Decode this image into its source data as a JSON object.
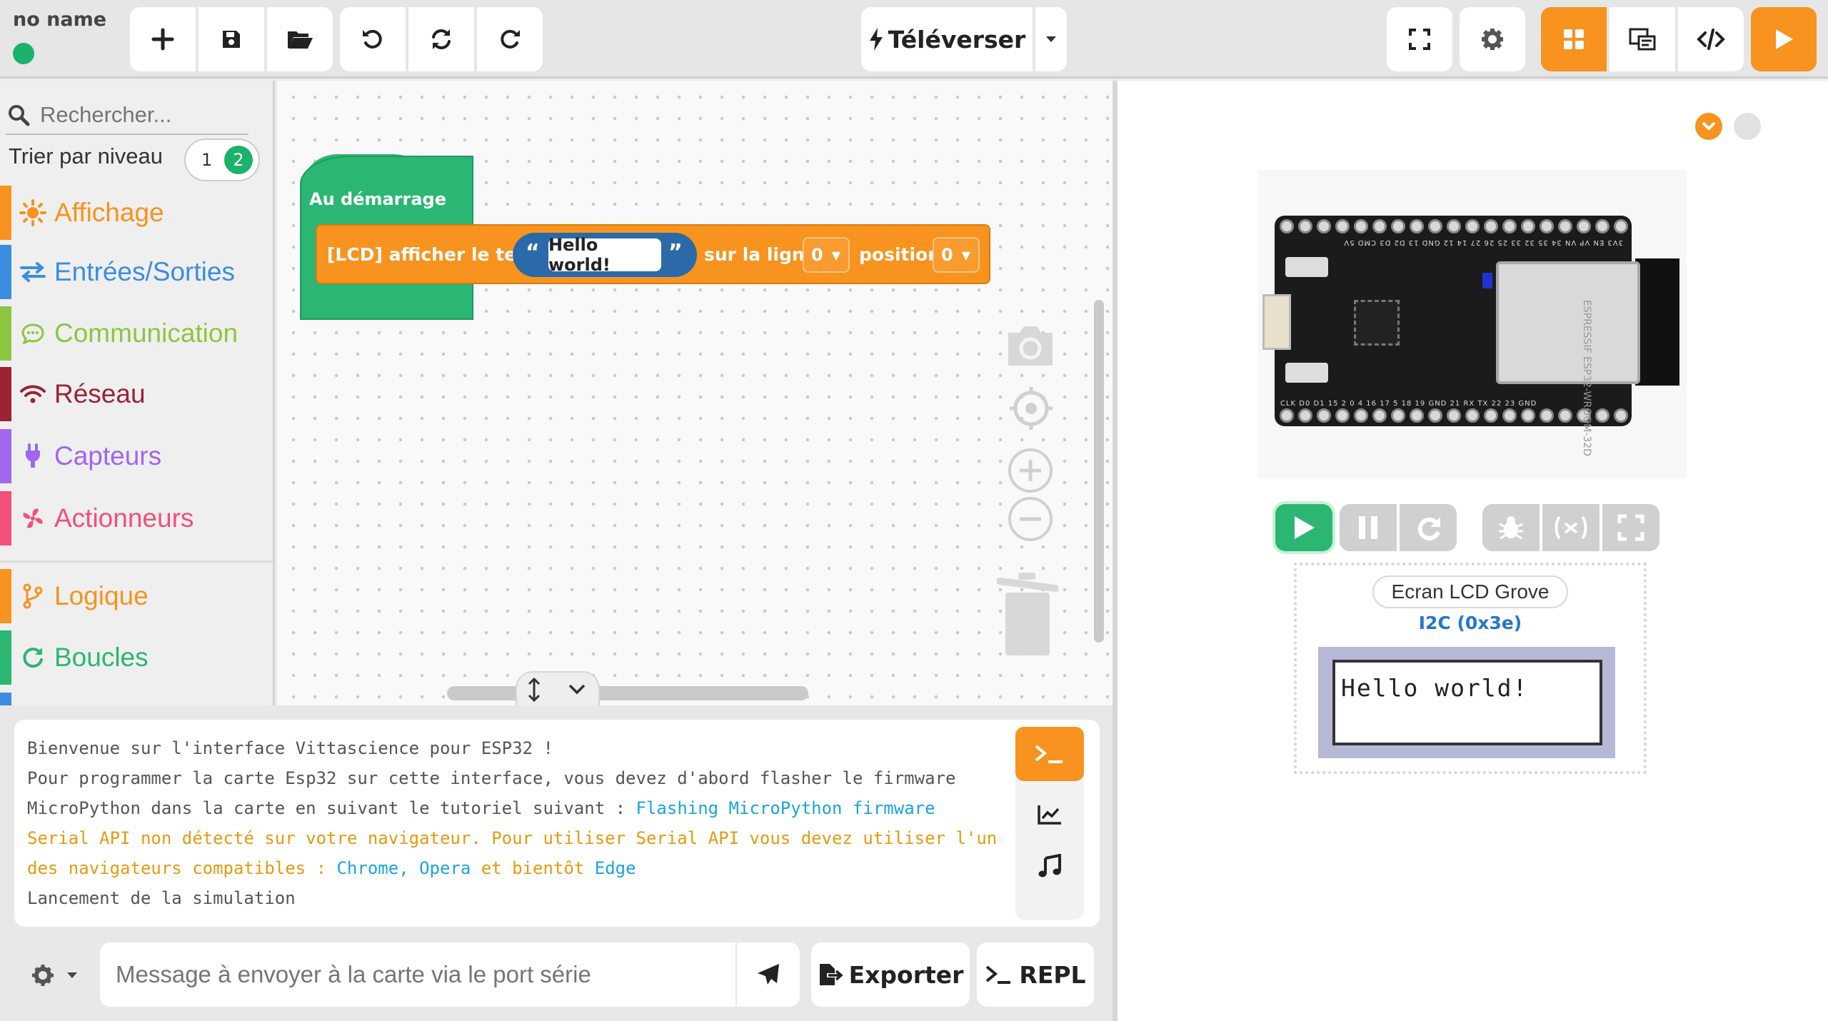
{
  "project": {
    "name": "no name",
    "status_color": "#1bb26b"
  },
  "toolbar": {
    "new_icon": "plus-icon",
    "save_icon": "floppy-icon",
    "open_icon": "folder-open-icon",
    "undo_icon": "undo-icon",
    "sync_icon": "sync-icon",
    "redo_icon": "redo-icon",
    "upload_label": "Téléverser",
    "accent": "#f7931e"
  },
  "sidebar": {
    "search_placeholder": "Rechercher...",
    "sort_label": "Trier par niveau",
    "level_1": "1",
    "level_2": "2",
    "categories": [
      {
        "label": "Affichage",
        "color": "#f7931e",
        "icon": "sun-icon"
      },
      {
        "label": "Entrées/Sorties",
        "color": "#3b8ee0",
        "icon": "arrows-icon"
      },
      {
        "label": "Communication",
        "color": "#8cc63f",
        "icon": "chat-icon"
      },
      {
        "label": "Réseau",
        "color": "#9b2335",
        "icon": "wifi-icon"
      },
      {
        "label": "Capteurs",
        "color": "#a066f0",
        "icon": "plug-icon"
      },
      {
        "label": "Actionneurs",
        "color": "#f0507a",
        "icon": "fan-icon"
      },
      {
        "label": "Logique",
        "color": "#f7931e",
        "icon": "branch-icon"
      },
      {
        "label": "Boucles",
        "color": "#2bb673",
        "icon": "loop-icon"
      }
    ]
  },
  "workspace": {
    "hat_label": "Au démarrage",
    "lcd_label": "[LCD] afficher le texte",
    "text_value": "Hello world!",
    "line_label": "sur la ligne",
    "line_value": "0",
    "position_label": "position",
    "position_value": "0"
  },
  "console": {
    "lines": [
      "Bienvenue sur l'interface Vittascience pour ESP32 !",
      "Pour programmer la carte Esp32 sur cette interface, vous devez d'abord flasher le firmware",
      "MicroPython dans la carte en suivant le tutoriel suivant : ",
      "Serial API non détecté sur votre navigateur. Pour utiliser Serial API vous devez utiliser l'un",
      "des navigateurs compatibles : ",
      "Lancement de la simulation"
    ],
    "link_flash": "Flashing MicroPython firmware",
    "link_chrome": "Chrome",
    "comma": ",",
    "link_opera": "Opera",
    "and_soon": "et bientôt",
    "link_edge": "Edge",
    "serial_placeholder": "Message à envoyer à la carte via le port série",
    "export_label": "Exporter",
    "repl_label": "REPL"
  },
  "simulator": {
    "board_vendor": "ESPRESSIF",
    "board_module": "ESP32-WROOM-32D",
    "pins_top": "3V3 EN VP VN 34 35 32 33 25 26 27 14 12 GND 13 D2 D3 CMD 5V",
    "pins_bottom": "CLK D0 D1 15 2 0 4 16 17 5 18 19 GND 21 RX TX 22 23 GND",
    "lcd_name": "Ecran LCD Grove",
    "lcd_address": "I2C (0x3e)",
    "lcd_text": "Hello world!",
    "play_color": "#2bb673"
  }
}
